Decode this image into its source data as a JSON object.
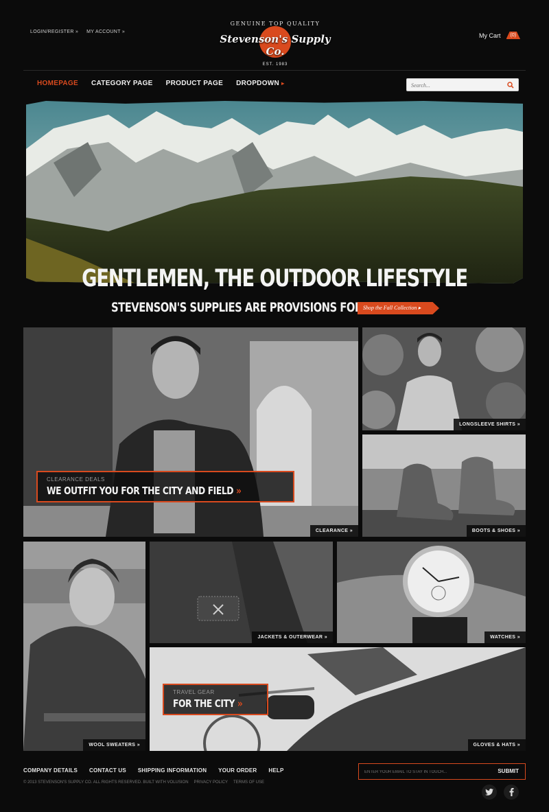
{
  "header": {
    "login_register": "LOGIN/REGISTER »",
    "my_account": "MY ACCOUNT »",
    "logo_top": "GENUINE TOP QUALITY",
    "logo_name": "Stevenson's Supply Co.",
    "logo_est": "EST. 1983",
    "cart_label": "My Cart",
    "cart_count": "(0)"
  },
  "nav": {
    "items": [
      "HOMEPAGE",
      "CATEGORY PAGE",
      "PRODUCT PAGE",
      "DROPDOWN"
    ],
    "dropdown_arrow": "▸"
  },
  "search": {
    "placeholder": "Search..."
  },
  "hero": {
    "headline": "GENTLEMEN, THE OUTDOOR LIFESTYLE",
    "subheadline": "STEVENSON'S SUPPLIES ARE PROVISIONS FOR MEN",
    "cta": "Shop the Fall Collection ▸"
  },
  "tiles": {
    "clearance": "CLEARANCE »",
    "longsleeve": "LONGSLEEVE SHIRTS »",
    "boots": "BOOTS & SHOES »",
    "sweaters": "WOOL SWEATERS »",
    "jackets": "JACKETS & OUTERWEAR »",
    "watches": "WATCHES »",
    "gloves": "GLOVES & HATS »"
  },
  "promos": {
    "clearance_kicker": "CLEARANCE DEALS",
    "clearance_title": "WE OUTFIT YOU FOR THE CITY AND FIELD",
    "travel_kicker": "TRAVEL GEAR",
    "travel_title": "FOR THE CITY",
    "arrow": "»"
  },
  "footer": {
    "links": [
      "COMPANY DETAILS",
      "CONTACT US",
      "SHIPPING INFORMATION",
      "YOUR ORDER",
      "HELP"
    ],
    "copyright": "© 2013 STEVENSON'S SUPPLY CO. ALL RIGHTS RESERVED. BUILT WITH VOLUSION",
    "privacy": "PRIVACY POLICY",
    "terms": "TERMS OF USE",
    "newsletter_placeholder": "ENTER YOUR EMAIL TO STAY IN TOUCH...",
    "submit": "SUBMIT"
  },
  "icons": [
    "search-icon",
    "twitter-icon",
    "facebook-icon"
  ],
  "colors": {
    "accent": "#d94a1e",
    "background": "#0b0b0b"
  }
}
